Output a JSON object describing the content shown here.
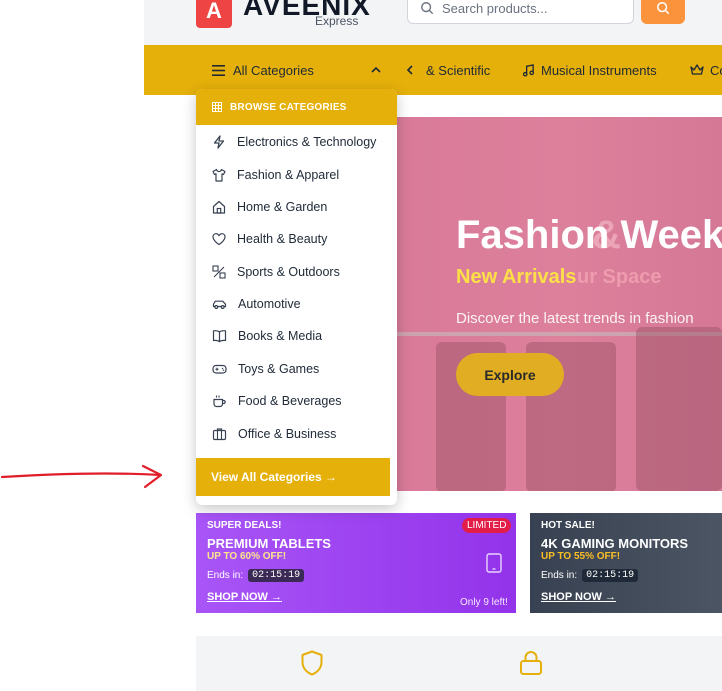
{
  "header": {
    "logo_letter": "A",
    "logo_name": "AVEENIX",
    "logo_sub": "Express",
    "search_placeholder": "Search products..."
  },
  "navbar": {
    "all_categories": "All Categories",
    "links": [
      {
        "label": "& Scientific",
        "icon": "none"
      },
      {
        "label": "Musical Instruments",
        "icon": "music-note-icon"
      },
      {
        "label": "Co",
        "icon": "crown-icon"
      }
    ]
  },
  "dropdown": {
    "heading": "BROWSE CATEGORIES",
    "items": [
      {
        "label": "Electronics & Technology",
        "icon": "lightning-icon"
      },
      {
        "label": "Fashion & Apparel",
        "icon": "shirt-icon"
      },
      {
        "label": "Home & Garden",
        "icon": "home-icon"
      },
      {
        "label": "Health & Beauty",
        "icon": "heart-icon"
      },
      {
        "label": "Sports & Outdoors",
        "icon": "sports-icon"
      },
      {
        "label": "Automotive",
        "icon": "car-icon"
      },
      {
        "label": "Books & Media",
        "icon": "book-icon"
      },
      {
        "label": "Toys & Games",
        "icon": "gamepad-icon"
      },
      {
        "label": "Food & Beverages",
        "icon": "coffee-icon"
      },
      {
        "label": "Office & Business",
        "icon": "briefcase-icon"
      }
    ],
    "view_all": "View All Categories →"
  },
  "hero": {
    "title": "Fashion Week",
    "title_ghost": "&",
    "subtitle": "New Arrivals",
    "subtitle_ghost": "ur Space",
    "description": "Discover the latest trends in fashion",
    "button": "Explore"
  },
  "deals": [
    {
      "tag": "SUPER DEALS!",
      "name": "PREMIUM TABLETS",
      "discount": "UP TO 60% OFF!",
      "ends_label": "Ends in:",
      "timer": "02:15:19",
      "shop": "SHOP NOW →",
      "badge": "LIMITED",
      "stock": "Only 9 left!"
    },
    {
      "tag": "HOT SALE!",
      "name": "4K GAMING MONITORS",
      "discount": "UP TO 55% OFF!",
      "ends_label": "Ends in:",
      "timer": "02:15:19",
      "shop": "SHOP NOW →"
    }
  ],
  "colors": {
    "brand_yellow": "#e5b00a",
    "logo_red": "#ef4444",
    "search_orange": "#fb923c",
    "annotation_red": "#e11d2a"
  }
}
